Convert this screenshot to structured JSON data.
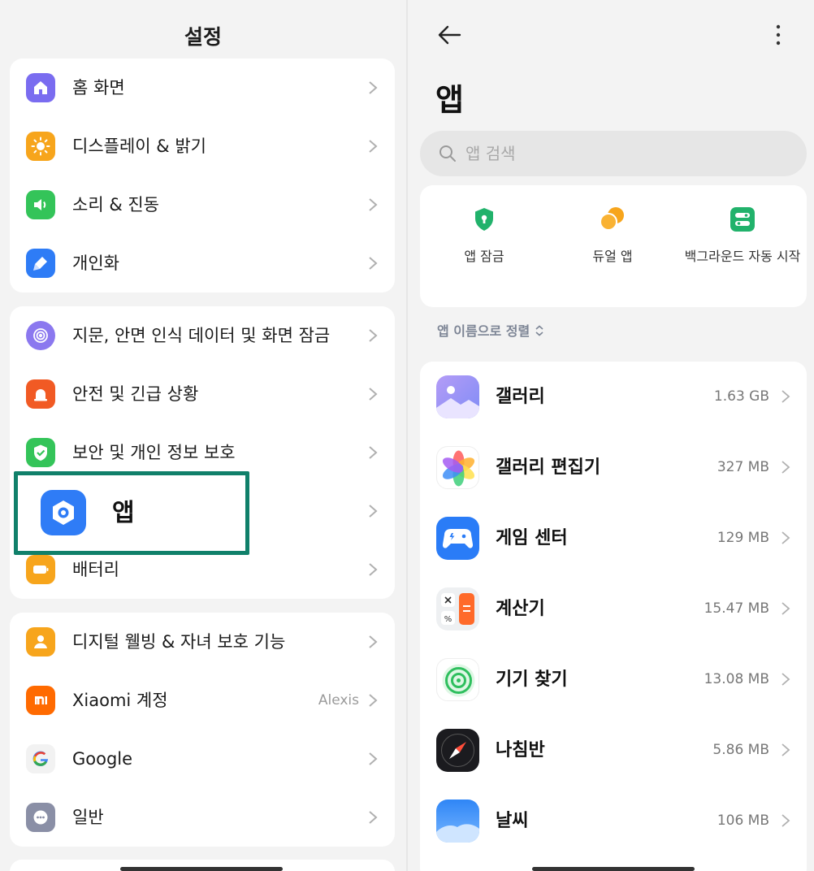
{
  "left": {
    "title": "설정",
    "groups": [
      [
        {
          "label": "홈 화면",
          "icon": "home-icon",
          "color": "#7a6cf0"
        },
        {
          "label": "디스플레이 & 밝기",
          "icon": "sun-icon",
          "color": "#f7a51c"
        },
        {
          "label": "소리 & 진동",
          "icon": "speaker-icon",
          "color": "#34c459"
        },
        {
          "label": "개인화",
          "icon": "brush-icon",
          "color": "#2e7cf6"
        }
      ],
      [
        {
          "label": "지문, 안면 인식 데이터 및 화면 잠금",
          "icon": "fingerprint-icon",
          "color": "#8b78ef"
        },
        {
          "label": "안전 및 긴급 상황",
          "icon": "alarm-icon",
          "color": "#f15a24"
        },
        {
          "label": "보안 및 개인 정보 보호",
          "icon": "shield-check-icon",
          "color": "#34c459"
        },
        {
          "label": "앱",
          "icon": "app-gear-icon",
          "color": "#2f7cf6"
        },
        {
          "label": "배터리",
          "icon": "battery-icon",
          "color": "#f7a51c"
        }
      ],
      [
        {
          "label": "디지털 웰빙 & 자녀 보호 기능",
          "icon": "wellbeing-icon",
          "color": "#f7a51c"
        },
        {
          "label": "Xiaomi 계정",
          "icon": "mi-icon",
          "color": "#ff6a00",
          "value": "Alexis"
        },
        {
          "label": "Google",
          "icon": "google-icon",
          "color": "#f2f2f2"
        },
        {
          "label": "일반",
          "icon": "more-dots-icon",
          "color": "#8a8fa6"
        }
      ]
    ]
  },
  "right": {
    "title": "앱",
    "search_placeholder": "앱 검색",
    "quick_actions": [
      {
        "label": "앱 잠금",
        "icon": "shield-lock-icon",
        "color": "#21b26b"
      },
      {
        "label": "듀얼 앱",
        "icon": "dual-circle-icon",
        "color": "#f7a51c"
      },
      {
        "label": "백그라운드 자동 시작",
        "icon": "toggle-icon",
        "color": "#21b26b"
      }
    ],
    "sort_label": "앱 이름으로 정렬",
    "apps": [
      {
        "name": "갤러리",
        "size": "1.63 GB",
        "icon": "gallery-icon"
      },
      {
        "name": "갤러리 편집기",
        "size": "327 MB",
        "icon": "gallery-editor-icon"
      },
      {
        "name": "게임 센터",
        "size": "129 MB",
        "icon": "game-center-icon"
      },
      {
        "name": "계산기",
        "size": "15.47 MB",
        "icon": "calculator-icon"
      },
      {
        "name": "기기 찾기",
        "size": "13.08 MB",
        "icon": "find-device-icon"
      },
      {
        "name": "나침반",
        "size": "5.86 MB",
        "icon": "compass-icon"
      },
      {
        "name": "날씨",
        "size": "106 MB",
        "icon": "weather-icon"
      }
    ]
  }
}
